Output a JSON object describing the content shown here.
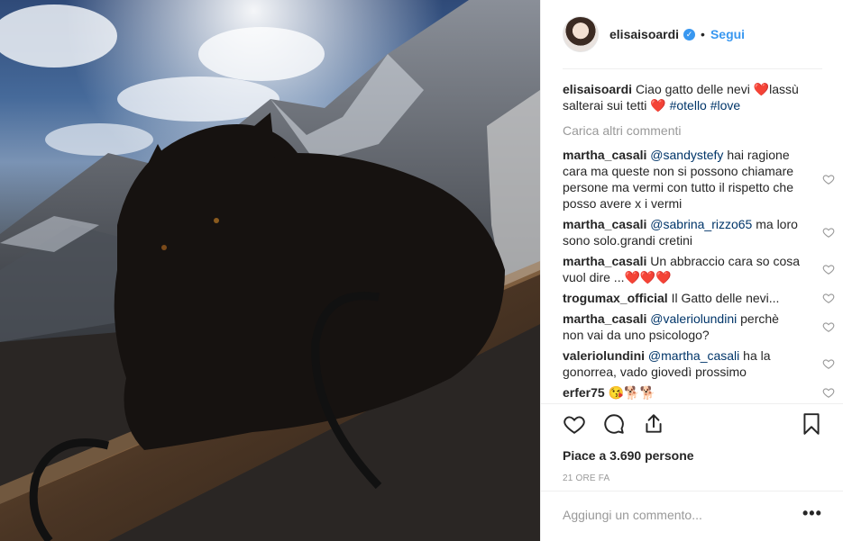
{
  "post": {
    "username": "elisaisoardi",
    "verified_badge": "✓",
    "separator": "•",
    "follow_label": "Segui",
    "caption_user": "elisaisoardi",
    "caption_part1": "Ciao gatto delle nevi ",
    "caption_heart1": "❤️",
    "caption_part2": "lassù salterai sui tetti ",
    "caption_heart2": "❤️",
    "caption_tags": " #otello #love",
    "load_more": "Carica altri commenti",
    "likes_text": "Piace a 3.690 persone",
    "time_ago": "21 ORE FA",
    "add_comment_placeholder": "Aggiungi un commento...",
    "more_label": "•••"
  },
  "comments": [
    {
      "user": "martha_casali",
      "mention": "@sandystefy",
      "text": " hai ragione cara ma queste non si possono chiamare persone ma vermi con tutto il rispetto che posso avere x i vermi"
    },
    {
      "user": "martha_casali",
      "mention": "@sabrina_rizzo65",
      "text": " ma loro sono solo.grandi cretini"
    },
    {
      "user": "martha_casali",
      "mention": "",
      "text": " Un abbraccio cara so cosa vuol dire ...❤️❤️❤️"
    },
    {
      "user": "trogumax_official",
      "mention": "",
      "text": " Il Gatto delle nevi..."
    },
    {
      "user": "martha_casali",
      "mention": "@valeriolundini",
      "text": " perchè non vai da uno psicologo?"
    },
    {
      "user": "valeriolundini",
      "mention": "@martha_casali",
      "text": " ha la gonorrea, vado giovedì prossimo"
    },
    {
      "user": "erfer75",
      "mention": "",
      "text": " 😘🐕🐕"
    }
  ],
  "icons": {
    "like": "heart-outline-icon",
    "comment": "comment-bubble-icon",
    "share": "share-icon",
    "save": "bookmark-icon"
  },
  "colors": {
    "link": "#3897f0",
    "mention": "#003569",
    "muted": "#999999"
  }
}
